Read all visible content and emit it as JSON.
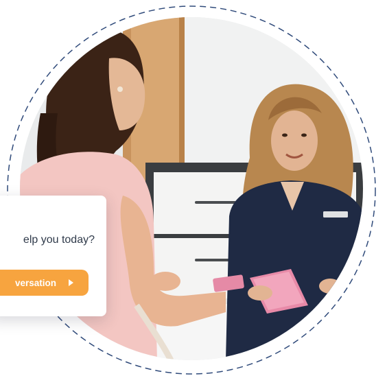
{
  "chat_widget": {
    "question": "elp you today?",
    "cta_label": "versation",
    "cta_icon": "play-icon"
  },
  "colors": {
    "accent": "#f7a43f",
    "ring": "#2f4a7a",
    "card_text": "#2f3a4a"
  },
  "photo": {
    "subject": "receptionist-with-tablet",
    "visitor": "woman-in-pink-top"
  }
}
